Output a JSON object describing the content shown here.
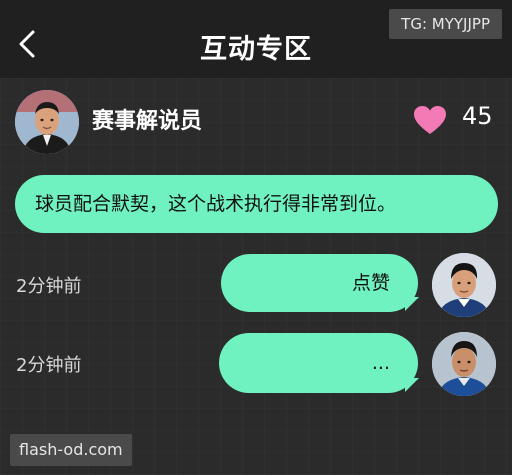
{
  "header": {
    "title": "互动专区",
    "back_icon": "chevron-left-icon"
  },
  "watermark_top": "TG: MYYJJPP",
  "comment": {
    "author": "赛事解说员",
    "likes": "45",
    "like_icon": "heart-icon",
    "text": "球员配合默契，这个战术执行得非常到位。"
  },
  "replies": [
    {
      "time": "2分钟前",
      "text": "点赞"
    },
    {
      "time": "2分钟前",
      "text": "..."
    }
  ],
  "watermark_bottom": "flash-od.com",
  "colors": {
    "bubble": "#6ff2c0",
    "heart": "#f47ab5",
    "background": "#2b2b2c",
    "header": "#202021"
  }
}
